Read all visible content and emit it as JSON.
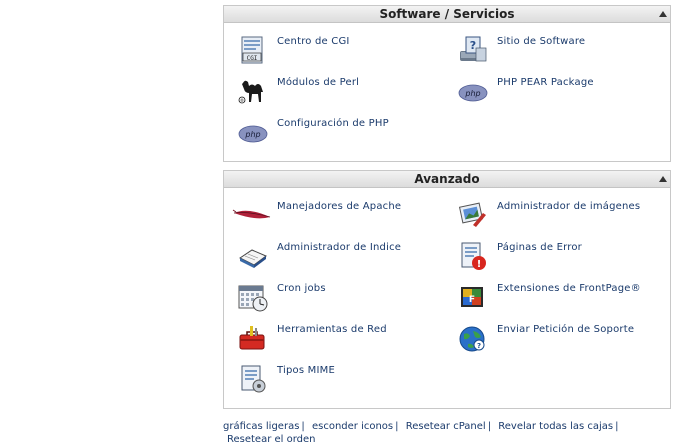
{
  "software_panel": {
    "title": "Software / Servicios",
    "items": [
      {
        "label": "Centro de CGI",
        "icon": "cgi-icon"
      },
      {
        "label": "Sitio de Software",
        "icon": "software-site-icon"
      },
      {
        "label": "Módulos de Perl",
        "icon": "perl-camel-icon"
      },
      {
        "label": "PHP PEAR Package",
        "icon": "php-icon"
      },
      {
        "label": "Configuración de PHP",
        "icon": "php-icon"
      }
    ]
  },
  "advanced_panel": {
    "title": "Avanzado",
    "items": [
      {
        "label": "Manejadores de Apache",
        "icon": "apache-feather-icon"
      },
      {
        "label": "Administrador de imágenes",
        "icon": "image-manager-icon"
      },
      {
        "label": "Administrador de Indice",
        "icon": "index-manager-icon"
      },
      {
        "label": "Páginas de Error",
        "icon": "error-pages-icon"
      },
      {
        "label": "Cron jobs",
        "icon": "calendar-clock-icon"
      },
      {
        "label": "Extensiones de FrontPage®",
        "icon": "frontpage-icon"
      },
      {
        "label": "Herramientas de Red",
        "icon": "toolbox-icon"
      },
      {
        "label": "Enviar Petición de Soporte",
        "icon": "support-globe-icon"
      },
      {
        "label": "Tipos MIME",
        "icon": "mime-types-icon"
      }
    ]
  },
  "footer": {
    "links": [
      "gráficas ligeras",
      "esconder iconos",
      "Resetear cPanel",
      "Revelar todas las cajas",
      "Resetear el orden"
    ],
    "separator": "|"
  }
}
